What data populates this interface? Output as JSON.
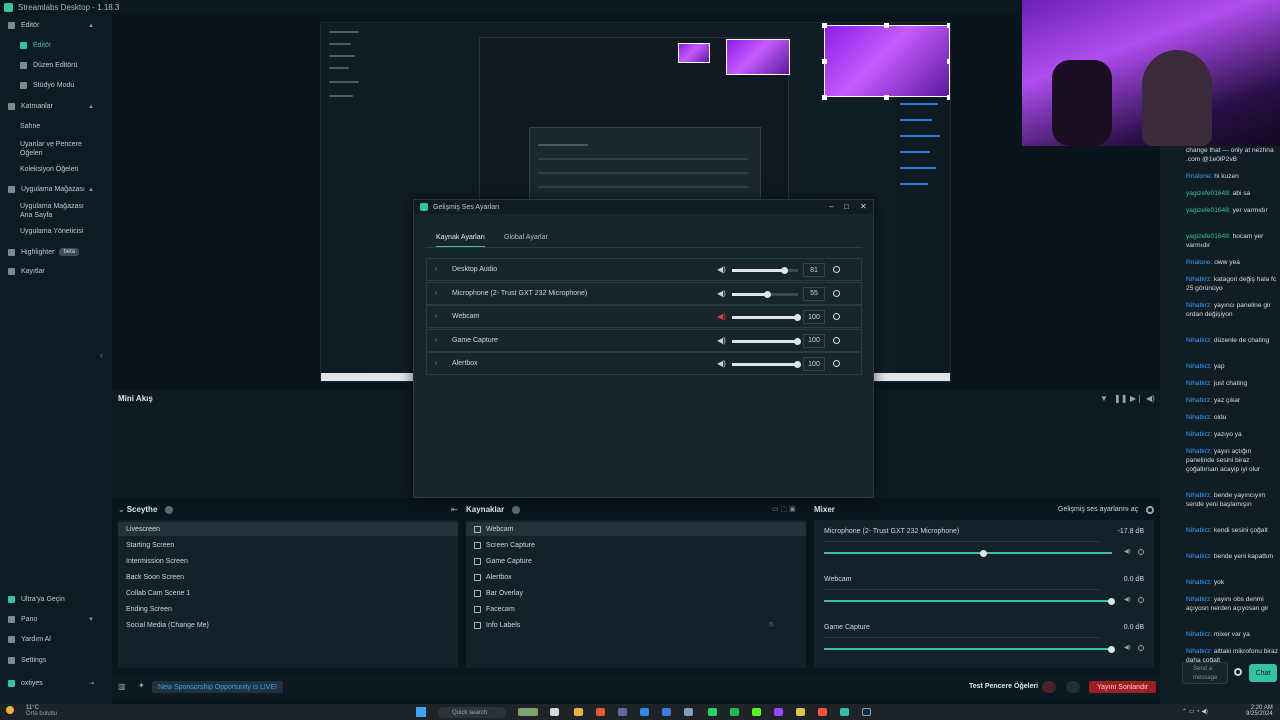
{
  "window": {
    "title": "Streamlabs Desktop - 1.18.3"
  },
  "sidebar": {
    "items": [
      {
        "label": "Editör",
        "section": true
      },
      {
        "label": "Editör",
        "selected": true
      },
      {
        "label": "Düzen Editörü"
      },
      {
        "label": "Stüdyo Modu"
      },
      {
        "label": "Katmanlar",
        "section": true
      },
      {
        "label": "Sahne"
      },
      {
        "label": "Uyarılar ve Pencere Öğeleri"
      },
      {
        "label": "Koleksiyon Öğeleri"
      },
      {
        "label": "Uygulama Mağazası",
        "section": true
      },
      {
        "label": "Uygulama Mağazası Ana Sayfa"
      },
      {
        "label": "Uygulama Yöneticisi"
      },
      {
        "label": "Highlighter",
        "badge": "beta"
      },
      {
        "label": "Kayıtlar"
      }
    ],
    "bottom": [
      "Ultra'ya Geçin",
      "Pano",
      "Yardım Al",
      "Settings",
      "oxtiyes"
    ]
  },
  "mini_feed": {
    "title": "Mini Akış"
  },
  "scenes": {
    "title": "Sceythe",
    "items": [
      "Livescreen",
      "Starting Screen",
      "Intermission Screen",
      "Back Soon Screen",
      "Collab Cam Scene 1",
      "Ending Screen",
      "Social Media (Change Me)"
    ]
  },
  "sources": {
    "title": "Kaynaklar",
    "items": [
      "Webcam",
      "Screen Capture",
      "Game Capture",
      "Alertbox",
      "Bar Overlay",
      "Facecam",
      "Info Labels"
    ]
  },
  "mixer": {
    "title": "Mixer",
    "advanced_link": "Gelişmiş ses ayarlarını aç",
    "channels": [
      {
        "name": "Microphone (2- Trust GXT 232 Microphone)",
        "db": "-17.8 dB",
        "level": 0.55
      },
      {
        "name": "Webcam",
        "db": "0.0 dB",
        "level": 1.0
      },
      {
        "name": "Game Capture",
        "db": "0.0 dB",
        "level": 1.0
      }
    ]
  },
  "modal": {
    "title": "Gelişmiş Ses Ayarları",
    "tabs": [
      "Kaynak Ayarları",
      "Global Ayarlar"
    ],
    "sources": [
      {
        "name": "Desktop Audio",
        "value": "81",
        "level": 0.81,
        "muted": false
      },
      {
        "name": "Microphone (2- Trust GXT 232 Microphone)",
        "value": "55",
        "level": 0.55,
        "muted": false
      },
      {
        "name": "Webcam",
        "value": "100",
        "level": 1.0,
        "muted": true
      },
      {
        "name": "Game Capture",
        "value": "100",
        "level": 1.0,
        "muted": false
      },
      {
        "name": "Alertbox",
        "value": "100",
        "level": 1.0,
        "muted": false
      }
    ]
  },
  "chat": {
    "messages": [
      {
        "user": "",
        "text": "change that — only at nezhna .com @1e0lP2vB"
      },
      {
        "user": "Rnalone:",
        "text": "hi kuzen"
      },
      {
        "user": "yagizefe01648:",
        "text": "abi sa"
      },
      {
        "user": "yagizefe01648:",
        "text": "yer varmıdır"
      },
      {
        "user": "yagizefe01648:",
        "text": "hocam yer varmıdır"
      },
      {
        "user": "Rnalone:",
        "text": "oww yea"
      },
      {
        "user": "Nihatkrz:",
        "text": "katagori değiş hala fc 25 görünüyo"
      },
      {
        "user": "Nihatkrz:",
        "text": "yayıncı paneline gir ordan değişiyon"
      },
      {
        "user": "Nihatkrz:",
        "text": "düzenle de chating"
      },
      {
        "user": "Nihatkrz:",
        "text": "yap"
      },
      {
        "user": "Nihatkrz:",
        "text": "just chating"
      },
      {
        "user": "Nihatkrz:",
        "text": "yaz çıkar"
      },
      {
        "user": "Nihatkrz:",
        "text": "oldu"
      },
      {
        "user": "Nihatkrz:",
        "text": "yazıyo ya"
      },
      {
        "user": "Nihatkrz:",
        "text": "yayın açtığın panelinde sesini biraz çoğaltırsan acayip iyi olur"
      },
      {
        "user": "Nihatkrz:",
        "text": "bende yayıncıyım sende yeni başlamışın"
      },
      {
        "user": "Nihatkrz:",
        "text": "kendi sesini çoğalt"
      },
      {
        "user": "Nihatkrz:",
        "text": "bende yeni kapattım"
      },
      {
        "user": "Nihatkrz:",
        "text": "yok"
      },
      {
        "user": "Nihatkrz:",
        "text": "yayını obs denmi açıyosn nerden açıyosan gir"
      },
      {
        "user": "Nihatkrz:",
        "text": "mixer var ya"
      },
      {
        "user": "Nihatkrz:",
        "text": "alttaki mikrofonu biraz daha çoğalt"
      }
    ],
    "input_placeholder": "Send a message",
    "send_label": "Chat"
  },
  "bottombar": {
    "sponsor": "New Sponsorship Opportunity is LIVE!",
    "test_widgets": "Test Pencere Öğeleri",
    "end_stream": "Yayını Sonlandır"
  },
  "taskbar": {
    "weather_temp": "11°C",
    "weather_desc": "Orta bulutlu",
    "search": "Quick search",
    "time": "2:20 AM",
    "date": "9/25/2024"
  }
}
